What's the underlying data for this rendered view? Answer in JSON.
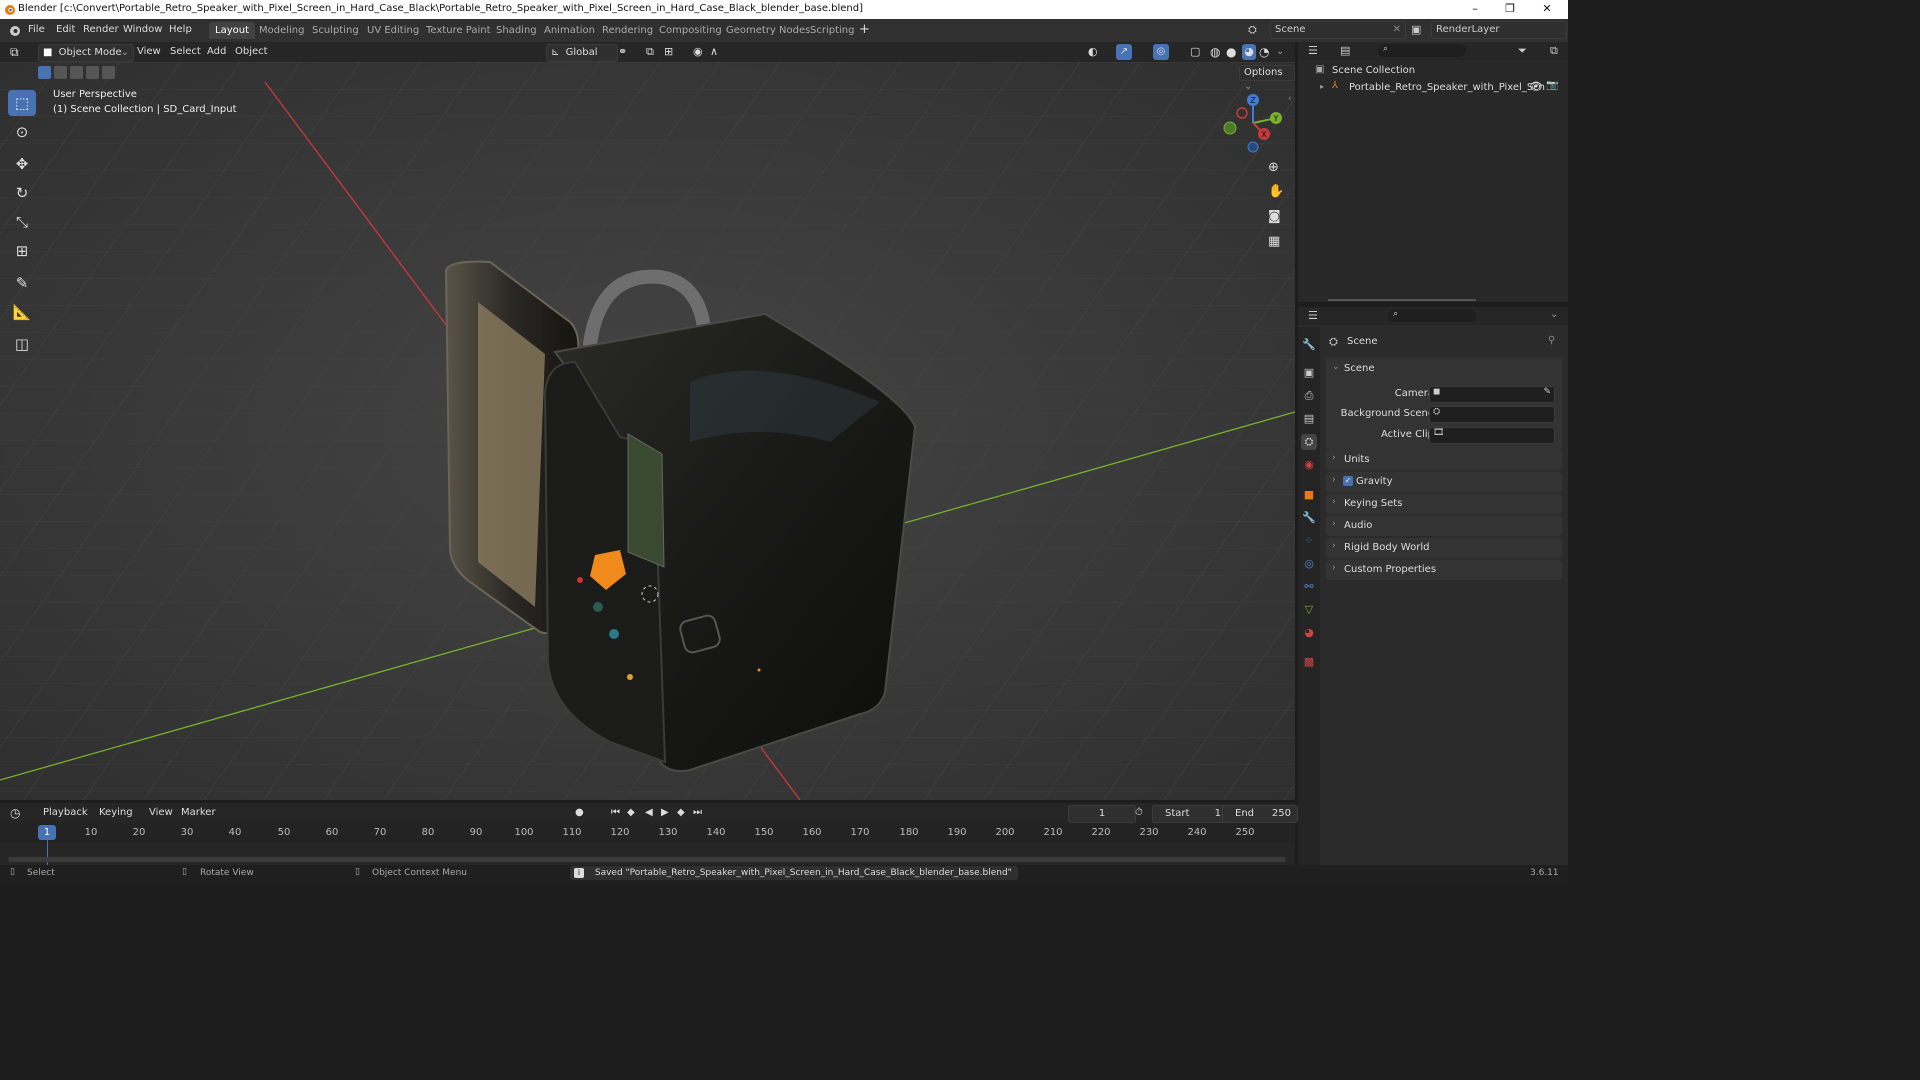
{
  "window": {
    "title": "Blender [c:\\Convert\\Portable_Retro_Speaker_with_Pixel_Screen_in_Hard_Case_Black\\Portable_Retro_Speaker_with_Pixel_Screen_in_Hard_Case_Black_blender_base.blend]",
    "controls": [
      "–",
      "❐",
      "✕"
    ]
  },
  "menu": [
    "File",
    "Edit",
    "Render",
    "Window",
    "Help"
  ],
  "workspaces": [
    "Layout",
    "Modeling",
    "Sculpting",
    "UV Editing",
    "Texture Paint",
    "Shading",
    "Animation",
    "Rendering",
    "Compositing",
    "Geometry Nodes",
    "Scripting"
  ],
  "active_workspace": "Layout",
  "scene_selector": "Scene",
  "renderlayer_selector": "RenderLayer",
  "viewport_header": {
    "mode": "Object Mode",
    "menus": [
      "View",
      "Select",
      "Add",
      "Object"
    ],
    "orientation": "Global",
    "options": "Options"
  },
  "viewport": {
    "perspective": "User Perspective",
    "collection_info": "(1) Scene Collection | SD_Card_Input",
    "gizmo": {
      "z": "Z",
      "y": "Y",
      "x": "X"
    }
  },
  "outliner": {
    "root": "Scene Collection",
    "item": "Portable_Retro_Speaker_with_Pixel_Scn"
  },
  "properties": {
    "context": "Scene",
    "panel_title": "Scene",
    "fields": {
      "camera": "Camera",
      "background_scene": "Background Scene",
      "active_clip": "Active Clip"
    },
    "sections": [
      "Units",
      "Gravity",
      "Keying Sets",
      "Audio",
      "Rigid Body World",
      "Custom Properties"
    ],
    "gravity_checked": true
  },
  "timeline": {
    "menus": [
      "Playback",
      "Keying",
      "View",
      "Marker"
    ],
    "current_frame": "1",
    "start_label": "Start",
    "start": "1",
    "end_label": "End",
    "end": "250",
    "ruler_current": "1",
    "ruler": [
      "10",
      "20",
      "30",
      "40",
      "50",
      "60",
      "70",
      "80",
      "90",
      "100",
      "110",
      "120",
      "130",
      "140",
      "150",
      "160",
      "170",
      "180",
      "190",
      "200",
      "210",
      "220",
      "230",
      "240",
      "250"
    ]
  },
  "statusbar": {
    "select": "Select",
    "rotate": "Rotate View",
    "context_menu": "Object Context Menu",
    "message": "Saved \"Portable_Retro_Speaker_with_Pixel_Screen_in_Hard_Case_Black_blender_base.blend\"",
    "version": "3.6.11"
  },
  "colors": {
    "accent": "#4772b3",
    "x_axis": "#c8393e",
    "y_axis": "#7ab02a",
    "z_axis": "#3f7dd8",
    "orange": "#f08a1c"
  }
}
